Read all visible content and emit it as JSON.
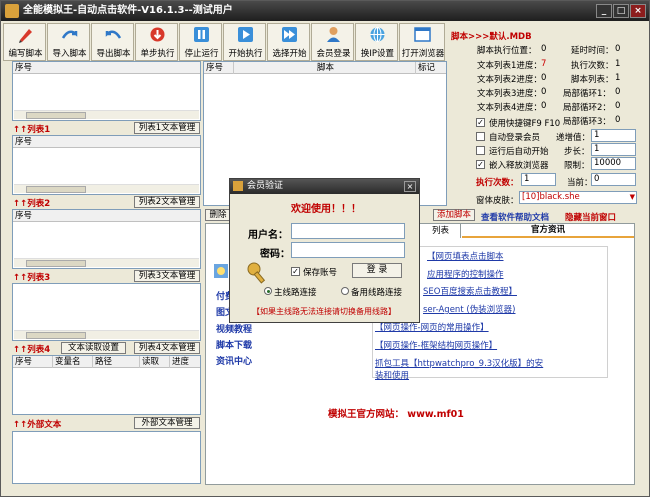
{
  "window": {
    "title": "全能模拟王-自动点击软件-V16.1.3--测试用户",
    "minimize": "_",
    "maximize": "□",
    "close": "×"
  },
  "toolbar": {
    "buttons": [
      {
        "label": "编写脚本",
        "icon": "pencil-icon"
      },
      {
        "label": "导入脚本",
        "icon": "import-icon"
      },
      {
        "label": "导出脚本",
        "icon": "export-icon"
      },
      {
        "label": "单步执行",
        "icon": "step-icon"
      },
      {
        "label": "停止运行",
        "icon": "pause-icon"
      },
      {
        "label": "开始执行",
        "icon": "play-icon"
      },
      {
        "label": "选择开始",
        "icon": "fast-forward-icon"
      },
      {
        "label": "会员登录",
        "icon": "user-icon"
      },
      {
        "label": "换IP设置",
        "icon": "ip-icon"
      },
      {
        "label": "打开浏览器",
        "icon": "browser-icon"
      }
    ]
  },
  "left": {
    "pane0_header": "序号",
    "list1_label": "↑↑列表1",
    "list1_btn": "列表1文本管理",
    "pane1_header": "序号",
    "list2_label": "↑↑列表2",
    "list2_btn": "列表2文本管理",
    "pane2_header": "序号",
    "list3_label": "↑↑列表3",
    "list3_btn": "列表3文本管理",
    "list4_label": "↑↑列表4",
    "text_read_btn": "文本读取设置",
    "list4_btn": "列表4文本管理",
    "pane4_headers": [
      "序号",
      "变量名",
      "路径",
      "读取",
      "进度"
    ],
    "external_label": "↑↑外部文本",
    "external_btn": "外部文本管理"
  },
  "script_table": {
    "headers": [
      "序号",
      "脚本",
      "标记"
    ]
  },
  "right": {
    "script_name": "脚本>>>默认.MDB",
    "stats": [
      {
        "label": "脚本执行位置：",
        "value": "0",
        "color": "#000000"
      },
      {
        "label": "延时时间：",
        "value": "0",
        "color": "#000000"
      },
      {
        "label": "文本列表1进度：",
        "value": "7",
        "color": "#cc0000"
      },
      {
        "label": "执行次数：",
        "value": "1",
        "color": "#000000"
      },
      {
        "label": "文本列表2进度：",
        "value": "0",
        "color": "#000000"
      },
      {
        "label": "脚本列表：",
        "value": "1",
        "color": "#000000"
      },
      {
        "label": "文本列表3进度：",
        "value": "0",
        "color": "#000000"
      },
      {
        "label": "局部循环1：",
        "value": "0",
        "color": "#000000"
      },
      {
        "label": "文本列表4进度：",
        "value": "0",
        "color": "#000000"
      },
      {
        "label": "局部循环2：",
        "value": "0",
        "color": "#000000"
      },
      {
        "label": "局部循环3：",
        "value": "0",
        "color": "#000000"
      }
    ],
    "hotkey_label": "使用快捷键F9 F10",
    "auto_login_label": "自动登录会员",
    "recursion_label": "递增值：",
    "recursion_value": "1",
    "auto_start_label": "运行后自动开始",
    "step_label": "步长：",
    "step_value": "1",
    "embed_browser_label": "嵌入释放浏览器",
    "limit_label": "限制：",
    "limit_value": "10000",
    "exec_count_label": "执行次数：",
    "exec_count_value": "1",
    "current_label": "当前：",
    "current_value": "0",
    "skin_label": "窗体皮肤：",
    "skin_value": "[10]black.she",
    "hide_window": "隐藏当前窗口"
  },
  "mid": {
    "delete_btn": "删除",
    "add_script_btn": "添加脚本",
    "help_link": "查看软件帮助文档",
    "tab_list": "列表",
    "tab_official": "官方资讯",
    "left_links": [
      "付费",
      "图文",
      "视频教程",
      "脚本下载",
      "资讯中心"
    ],
    "news": [
      "【网页填表点击脚本",
      "应用程序的控制操作",
      "SEO百度搜索点击教程】",
      "ser-Agent (伪装浏览器)",
      "【网页操作-网页的常用操作】",
      "【网页操作-框架结构网页操作】",
      "抓包工具【httpwatchpro_9.3汉化版】的安装和使用"
    ],
    "site_text": "模拟王官方网站： www.mf01"
  },
  "dialog": {
    "title": "会员验证",
    "close": "×",
    "welcome": "欢迎使用！！！",
    "username_label": "用户名：",
    "username_value": "",
    "password_label": "密码：",
    "password_value": "",
    "save_account": "保存账号",
    "login_btn": "登 录",
    "main_route": "主线路连接",
    "backup_route": "备用线路连接",
    "notice": "【如果主线路无法连接请切换备用线路】"
  }
}
